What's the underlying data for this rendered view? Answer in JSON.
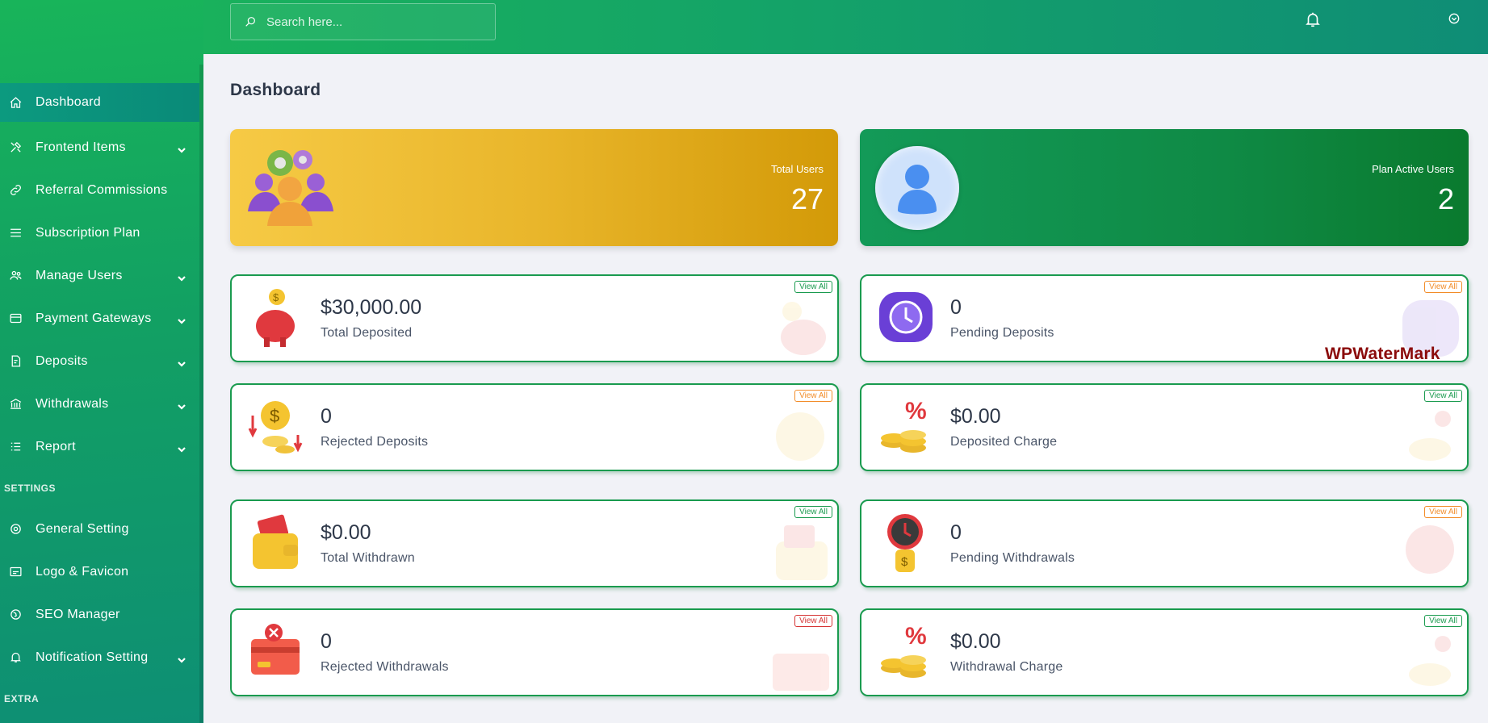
{
  "topbar": {
    "search_placeholder": "Search here..."
  },
  "sidebar": {
    "items": [
      {
        "label": "Dashboard",
        "icon": "home-icon",
        "active": true,
        "has_submenu": false
      },
      {
        "label": "Frontend Items",
        "icon": "tools-icon",
        "has_submenu": true
      },
      {
        "label": "Referral Commissions",
        "icon": "link-icon",
        "has_submenu": false
      },
      {
        "label": "Subscription Plan",
        "icon": "menu-lines-icon",
        "has_submenu": false
      },
      {
        "label": "Manage Users",
        "icon": "users-icon",
        "has_submenu": true
      },
      {
        "label": "Payment Gateways",
        "icon": "credit-card-icon",
        "has_submenu": true
      },
      {
        "label": "Deposits",
        "icon": "file-dollar-icon",
        "has_submenu": true
      },
      {
        "label": "Withdrawals",
        "icon": "bank-icon",
        "has_submenu": true
      },
      {
        "label": "Report",
        "icon": "list-icon",
        "has_submenu": true
      }
    ],
    "settings_heading": "SETTINGS",
    "settings_items": [
      {
        "label": "General Setting",
        "icon": "settings-icon",
        "has_submenu": false
      },
      {
        "label": "Logo & Favicon",
        "icon": "image-icon",
        "has_submenu": false
      },
      {
        "label": "SEO Manager",
        "icon": "globe-icon",
        "has_submenu": false
      },
      {
        "label": "Notification Setting",
        "icon": "bell-icon",
        "has_submenu": true
      }
    ],
    "extra_heading": "EXTRA"
  },
  "main": {
    "page_title": "Dashboard",
    "big_cards": [
      {
        "label": "Total Users",
        "value": "27",
        "color": "#e9b62b"
      },
      {
        "label": "Plan Active Users",
        "value": "2",
        "color": "#0f8a45"
      }
    ],
    "stat_cards": [
      {
        "value": "$30,000.00",
        "label": "Total Deposited",
        "view_all": "View All",
        "accent": "green"
      },
      {
        "value": "0",
        "label": "Pending Deposits",
        "view_all": "View All",
        "accent": "orange"
      },
      {
        "value": "0",
        "label": "Rejected Deposits",
        "view_all": "View All",
        "accent": "orange"
      },
      {
        "value": "$0.00",
        "label": "Deposited Charge",
        "view_all": "View All",
        "accent": "green"
      },
      {
        "value": "$0.00",
        "label": "Total Withdrawn",
        "view_all": "View All",
        "accent": "green"
      },
      {
        "value": "0",
        "label": "Pending Withdrawals",
        "view_all": "View All",
        "accent": "orange"
      },
      {
        "value": "0",
        "label": "Rejected Withdrawals",
        "view_all": "View All",
        "accent": "red"
      },
      {
        "value": "$0.00",
        "label": "Withdrawal Charge",
        "view_all": "View All",
        "accent": "green"
      }
    ]
  },
  "watermark": "WPWaterMark",
  "colors": {
    "brand_green": "#18b45a",
    "brand_teal": "#0f8d76",
    "card_border": "#1a9b4f",
    "view_all_orange": "#f28c28",
    "view_all_red": "#d53333"
  }
}
